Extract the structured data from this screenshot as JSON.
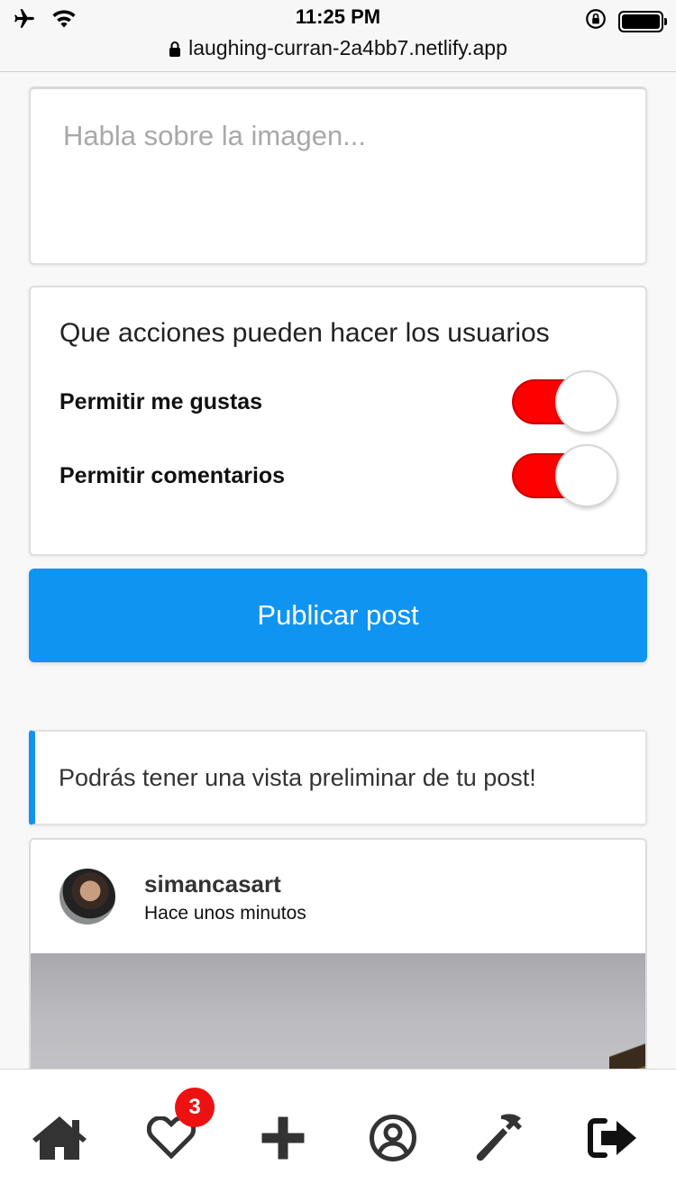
{
  "status_bar": {
    "time": "11:25 PM",
    "url": "laughing-curran-2a4bb7.netlify.app"
  },
  "composer": {
    "placeholder": "Habla sobre la imagen..."
  },
  "actions": {
    "title": "Que acciones pueden hacer los usuarios",
    "likes_label": "Permitir me gustas",
    "likes_enabled": true,
    "comments_label": "Permitir comentarios",
    "comments_enabled": true
  },
  "publish_label": "Publicar post",
  "preview_notice": "Podrás tener una vista preliminar de tu post!",
  "post_preview": {
    "username": "simancasart",
    "timestamp": "Hace unos minutos"
  },
  "bottom_nav": {
    "items": [
      {
        "icon": "home-icon"
      },
      {
        "icon": "heart-icon",
        "badge": "3"
      },
      {
        "icon": "plus-icon"
      },
      {
        "icon": "user-circle-icon"
      },
      {
        "icon": "hammer-icon"
      },
      {
        "icon": "sign-out-icon"
      }
    ]
  },
  "colors": {
    "accent": "#0f94f2",
    "toggle_on": "#ff0000",
    "badge": "#ee1111"
  }
}
